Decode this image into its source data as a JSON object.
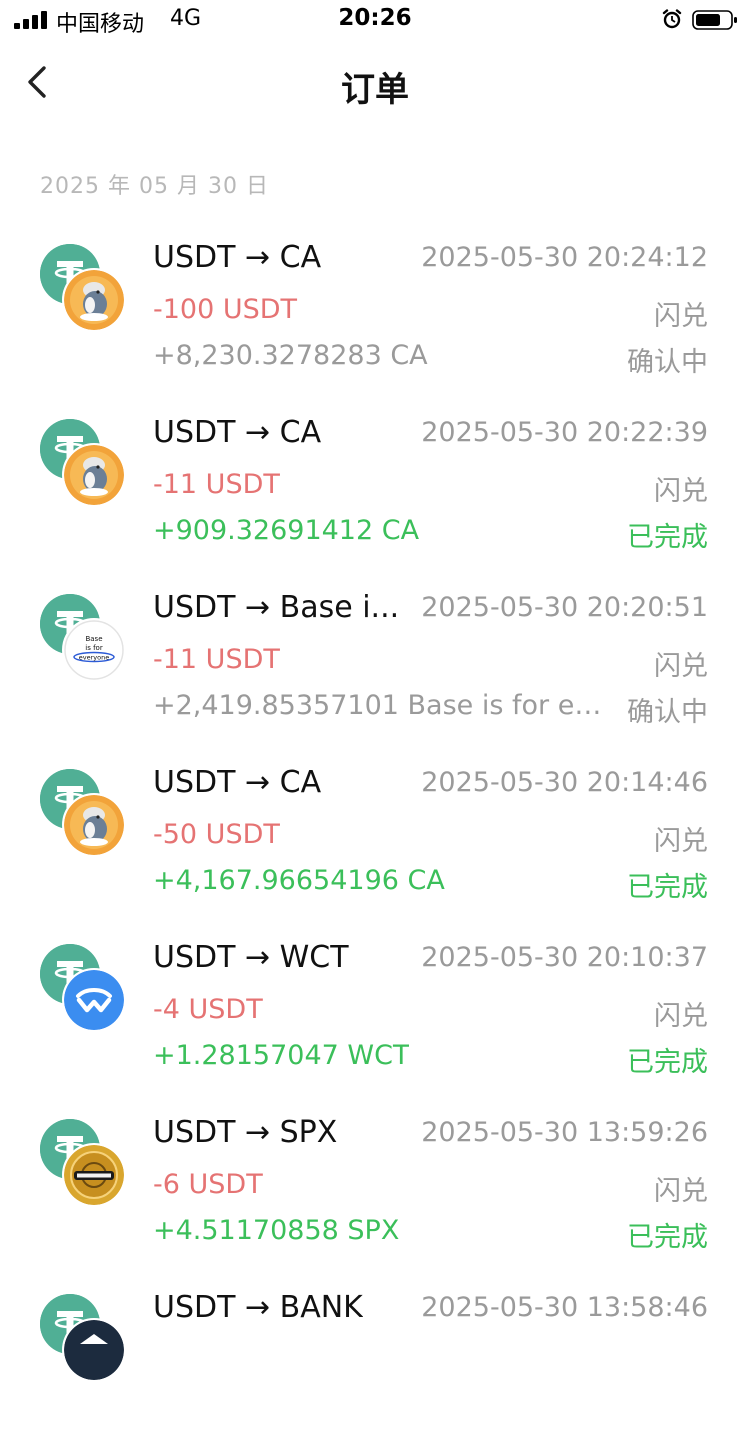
{
  "status_bar": {
    "carrier": "中国移动",
    "network": "4G",
    "time": "20:26"
  },
  "nav": {
    "title": "订单"
  },
  "date_header": "2025 年 05 月 30 日",
  "colors": {
    "negative": "#e57373",
    "positive": "#3bbf5a",
    "pending": "#9a9a9a",
    "usdt": "#50AF95"
  },
  "orders": [
    {
      "token_icon": "ca-token-icon",
      "pair": "USDT → CA",
      "time": "2025-05-30 20:24:12",
      "sent": "-100 USDT",
      "type": "闪兑",
      "received": "+8,230.3278283 CA",
      "status": "确认中",
      "state": "pending"
    },
    {
      "token_icon": "ca-token-icon",
      "pair": "USDT → CA",
      "time": "2025-05-30 20:22:39",
      "sent": "-11 USDT",
      "type": "闪兑",
      "received": "+909.32691412 CA",
      "status": "已完成",
      "state": "done"
    },
    {
      "token_icon": "base-token-icon",
      "pair": "USDT → Base i...",
      "time": "2025-05-30 20:20:51",
      "sent": "-11 USDT",
      "type": "闪兑",
      "received": "+2,419.85357101 Base is for ever...",
      "status": "确认中",
      "state": "pending"
    },
    {
      "token_icon": "ca-token-icon",
      "pair": "USDT → CA",
      "time": "2025-05-30 20:14:46",
      "sent": "-50 USDT",
      "type": "闪兑",
      "received": "+4,167.96654196 CA",
      "status": "已完成",
      "state": "done"
    },
    {
      "token_icon": "wct-token-icon",
      "pair": "USDT → WCT",
      "time": "2025-05-30 20:10:37",
      "sent": "-4 USDT",
      "type": "闪兑",
      "received": "+1.28157047 WCT",
      "status": "已完成",
      "state": "done"
    },
    {
      "token_icon": "spx-token-icon",
      "pair": "USDT → SPX",
      "time": "2025-05-30 13:59:26",
      "sent": "-6 USDT",
      "type": "闪兑",
      "received": "+4.51170858 SPX",
      "status": "已完成",
      "state": "done"
    },
    {
      "token_icon": "bank-token-icon",
      "pair": "USDT → BANK",
      "time": "2025-05-30 13:58:46",
      "sent": "",
      "type": "",
      "received": "",
      "status": "",
      "state": "done"
    }
  ]
}
